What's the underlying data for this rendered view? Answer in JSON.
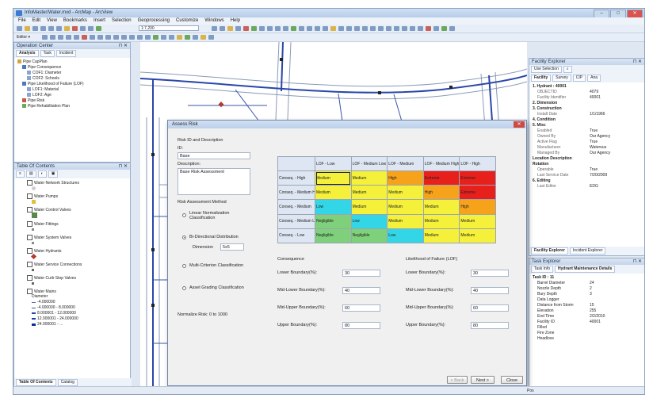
{
  "window": {
    "title": "InfoMaster/Water.mxd - ArcMap - ArcView",
    "min": "–",
    "max": "□",
    "close": "✕"
  },
  "menu": [
    "File",
    "Edit",
    "View",
    "Bookmarks",
    "Insert",
    "Selection",
    "Geoprocessing",
    "Customize",
    "Windows",
    "Help"
  ],
  "toolbar": {
    "scale": "1:7,200",
    "editor": "Editor ▾"
  },
  "operation_center": {
    "title": "Operation Center",
    "tabs": [
      "Analysis",
      "Task",
      "Incident"
    ],
    "tree": [
      {
        "label": "Pipe CapPlan",
        "level": 0
      },
      {
        "label": "Pipe Consequence",
        "level": 1
      },
      {
        "label": "COF1: Diameter",
        "level": 2
      },
      {
        "label": "COF2: Schools",
        "level": 2
      },
      {
        "label": "Pipe Likelihood of Failure (LOF)",
        "level": 1
      },
      {
        "label": "LOF1: Material",
        "level": 2
      },
      {
        "label": "LOF2: Age",
        "level": 2
      },
      {
        "label": "Pipe Risk",
        "level": 1
      },
      {
        "label": "Pipe Rehabilitation Plan",
        "level": 1
      }
    ]
  },
  "toc": {
    "title": "Table Of Contents",
    "layers": [
      "Water Network Structures",
      "Water Pumps",
      "Water Control Valves",
      "Water Fittings",
      "Water System Valves",
      "Water Hydrants",
      "Water Service Connections",
      "Water Curb Stop Valves",
      "Water Mains"
    ],
    "mains_label": "Diameter",
    "mains_classes": [
      "-4.000000",
      "-4.000000 - 8.000000",
      "8.000001 - 12.000000",
      "12.000001 - 24.000000",
      "24.000001 - ..."
    ],
    "bottom_tabs": [
      "Table Of Contents",
      "Catalog"
    ]
  },
  "facility_explorer": {
    "title": "Facility Explorer",
    "dropdown": "Use Selection",
    "tabs": [
      "Facility",
      "Survey",
      "CIP",
      "Ana"
    ],
    "header": "1. Hydrant : 40001",
    "rows": [
      [
        "OBJECTID",
        "4079"
      ],
      [
        "Facility Identifier",
        "40001"
      ],
      [
        "2. Dimension",
        ""
      ],
      [
        "3. Construction",
        ""
      ],
      [
        "Install Date",
        "1/1/1966"
      ],
      [
        "4. Condition",
        ""
      ],
      [
        "5. Misc",
        ""
      ],
      [
        "Enabled",
        "True"
      ],
      [
        "Owned By",
        "Our Agency"
      ],
      [
        "Active Flag",
        "True"
      ],
      [
        "Manufacturer",
        "Waterous"
      ],
      [
        "Managed By",
        "Our Agency"
      ],
      [
        "Location Description",
        ""
      ],
      [
        "Rotation",
        ""
      ],
      [
        "Operable",
        "True"
      ],
      [
        "Last Service Date",
        "7/20/2009"
      ],
      [
        "6. Editing",
        ""
      ],
      [
        "Last Editor",
        "EDG"
      ]
    ],
    "bottom_tabs": [
      "Facility Explorer",
      "Incident Explorer"
    ]
  },
  "task_explorer": {
    "title": "Task Explorer",
    "tabs": [
      "Task Info",
      "Hydrant Maintenance Details"
    ],
    "header": "Task ID : 11",
    "rows": [
      [
        "Barrel Diameter",
        "24"
      ],
      [
        "Nozzle Depth",
        "2"
      ],
      [
        "Bury Depth",
        "3"
      ],
      [
        "Data Logger",
        ""
      ],
      [
        "Distance from Storm",
        "15"
      ],
      [
        "Elevation",
        "255"
      ],
      [
        "End Time",
        "2/2/2010"
      ],
      [
        "Facility ID",
        "40001"
      ],
      [
        "Filled",
        ""
      ],
      [
        "Fire Zone",
        ""
      ],
      [
        "Headloss",
        ""
      ]
    ]
  },
  "dialog": {
    "title": "Assess Risk",
    "risk_id_label": "Risk ID and Description",
    "id_label": "ID:",
    "id_value": "Base",
    "desc_label": "Description:",
    "desc_value": "Base Risk Assessment",
    "method_label": "Risk Assessment Method",
    "methods": [
      {
        "label": "Linear Normalization Classification",
        "on": false
      },
      {
        "label": "Bi-Directional Distribution",
        "on": true
      },
      {
        "label": "Multi-Criterion Classification",
        "on": false
      },
      {
        "label": "Asset Grading Classification",
        "on": false
      }
    ],
    "dimension_label": "Dimension",
    "dimension_value": "5x5",
    "norm_label": "Normalize Risk: 0 to 1000",
    "matrix": {
      "cols": [
        "LOF - Low",
        "LOF - Medium Low",
        "LOF - Medium",
        "LOF - Medium High",
        "LOF - High"
      ],
      "rows": [
        {
          "label": "Conseq. - High",
          "cells": [
            "Medium",
            "Medium",
            "High",
            "Extreme",
            "Extreme"
          ]
        },
        {
          "label": "Conseq. - Medium High",
          "cells": [
            "Medium",
            "Medium",
            "Medium",
            "High",
            "Extreme"
          ]
        },
        {
          "label": "Conseq. - Medium",
          "cells": [
            "Low",
            "Medium",
            "Medium",
            "Medium",
            "High"
          ]
        },
        {
          "label": "Conseq. - Medium Low",
          "cells": [
            "Negligible",
            "Low",
            "Medium",
            "Medium",
            "Medium"
          ]
        },
        {
          "label": "Conseq. - Low",
          "cells": [
            "Negligible",
            "Negligible",
            "Low",
            "Medium",
            "Medium"
          ]
        }
      ]
    },
    "consequence_label": "Consequence",
    "lof_label": "Likelihood of Failure (LOF)",
    "bounds": [
      {
        "label": "Lower Boundary(%):",
        "cof": "30",
        "lof": "30"
      },
      {
        "label": "Mid-Lower Boundary(%):",
        "cof": "40",
        "lof": "40"
      },
      {
        "label": "Mid-Upper Boundary(%):",
        "cof": "60",
        "lof": "60"
      },
      {
        "label": "Upper Boundary(%):",
        "cof": "80",
        "lof": "80"
      }
    ],
    "buttons": {
      "back": "< Back",
      "next": "Next >",
      "close": "Close"
    }
  },
  "colors": {
    "Negligible": "#7fd07a",
    "Low": "#33d6e6",
    "Medium": "#f5f03a",
    "High": "#f7a21b",
    "Extreme": "#e8201c"
  },
  "status": {
    "pos": "Pos"
  }
}
